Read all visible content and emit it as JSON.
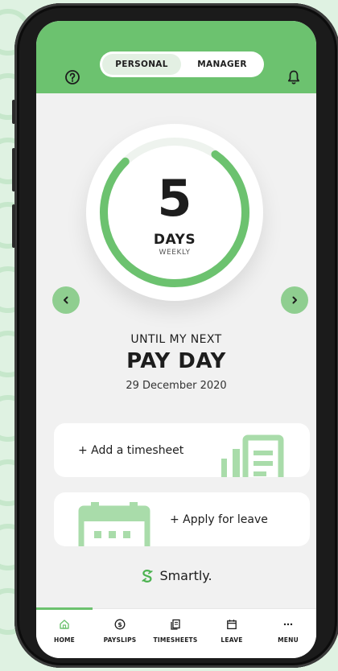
{
  "header": {
    "tabs": [
      {
        "label": "PERSONAL",
        "active": true
      },
      {
        "label": "MANAGER",
        "active": false
      }
    ]
  },
  "countdown": {
    "value": "5",
    "unit": "DAYS",
    "frequency": "WEEKLY",
    "ring_progress_fraction": 0.78
  },
  "payday": {
    "prefix": "UNTIL MY NEXT",
    "title": "PAY DAY",
    "date": "29 December 2020"
  },
  "actions": {
    "timesheet_label": "+ Add a timesheet",
    "leave_label": "+ Apply for leave"
  },
  "brand": {
    "name": "Smartly."
  },
  "tabbar": {
    "items": [
      {
        "label": "HOME",
        "icon": "home-icon",
        "active": true
      },
      {
        "label": "PAYSLIPS",
        "icon": "dollar-coin-icon",
        "active": false
      },
      {
        "label": "TIMESHEETS",
        "icon": "timesheet-icon",
        "active": false
      },
      {
        "label": "LEAVE",
        "icon": "calendar-icon",
        "active": false
      },
      {
        "label": "MENU",
        "icon": "more-icon",
        "active": false
      }
    ]
  },
  "colors": {
    "accent": "#6cc26f",
    "accent_light": "#8fce90",
    "background": "#f1f1f1",
    "page_bg": "#dff2e2"
  }
}
